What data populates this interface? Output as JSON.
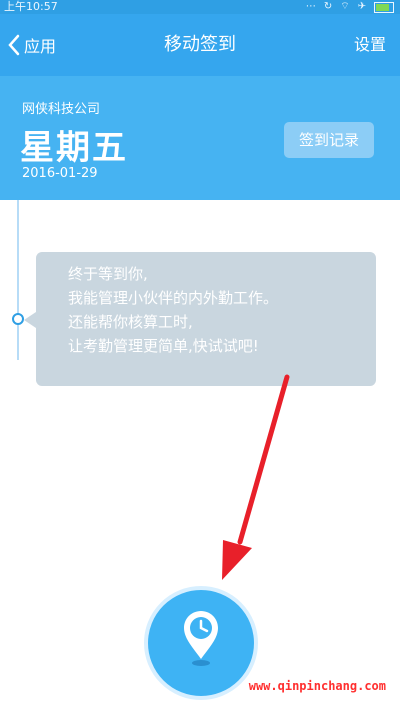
{
  "statusbar": {
    "time": "上午10:57"
  },
  "nav": {
    "back_label": "应用",
    "title": "移动签到",
    "settings_label": "设置"
  },
  "header": {
    "company": "网侠科技公司",
    "weekday": "星期五",
    "date": "2016-01-29",
    "record_button": "签到记录"
  },
  "bubble": {
    "lines": [
      "终于等到你,",
      "我能管理小伙伴的内外勤工作。",
      "还能帮你核算工时,",
      "让考勤管理更简单,快试试吧!"
    ]
  },
  "watermark": "www.qinpinchang.com",
  "colors": {
    "primary": "#35a6ee",
    "header_bg": "#46b3f2",
    "bubble_bg": "#c9d6df",
    "arrow": "#e8202a"
  }
}
